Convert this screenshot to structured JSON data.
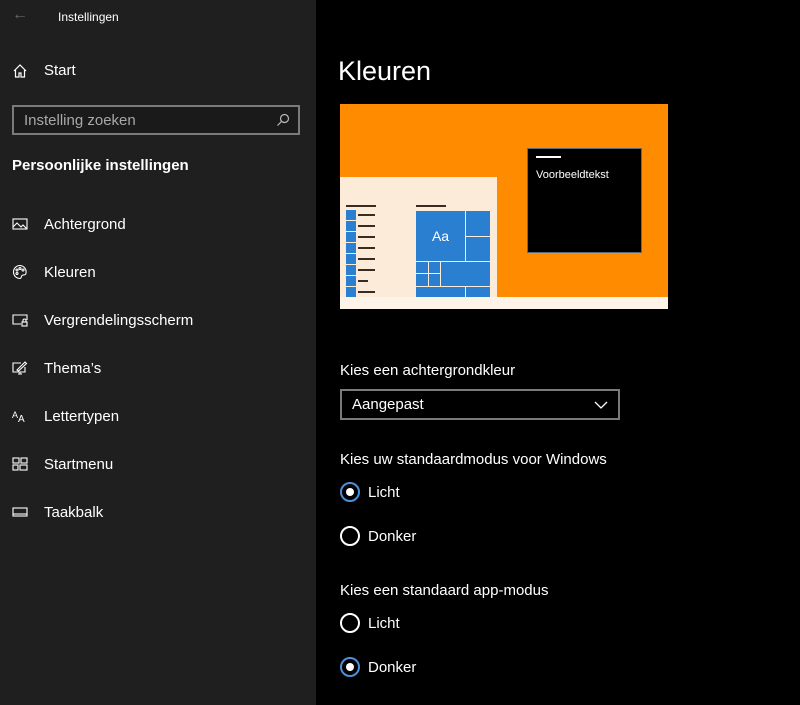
{
  "window": {
    "title": "Instellingen"
  },
  "sidebar": {
    "home": "Start",
    "search_placeholder": "Instelling zoeken",
    "section": "Persoonlijke instellingen",
    "items": [
      {
        "label": "Achtergrond",
        "icon": "picture-icon"
      },
      {
        "label": "Kleuren",
        "icon": "palette-icon"
      },
      {
        "label": "Vergrendelingsscherm",
        "icon": "lock-screen-icon"
      },
      {
        "label": "Thema’s",
        "icon": "theme-icon"
      },
      {
        "label": "Lettertypen",
        "icon": "font-icon"
      },
      {
        "label": "Startmenu",
        "icon": "start-menu-icon"
      },
      {
        "label": "Taakbalk",
        "icon": "taskbar-icon"
      }
    ]
  },
  "main": {
    "title": "Kleuren",
    "preview": {
      "sample_text": "Voorbeeldtekst",
      "tile_text": "Aa",
      "accent": "#ff8c00",
      "tile_color": "#2b7fd0"
    },
    "background_color": {
      "label": "Kies een achtergrondkleur",
      "value": "Aangepast"
    },
    "windows_mode": {
      "label": "Kies uw standaardmodus voor Windows",
      "options": [
        "Licht",
        "Donker"
      ],
      "selected": "Licht"
    },
    "app_mode": {
      "label": "Kies een standaard app-modus",
      "options": [
        "Licht",
        "Donker"
      ],
      "selected": "Donker"
    }
  }
}
